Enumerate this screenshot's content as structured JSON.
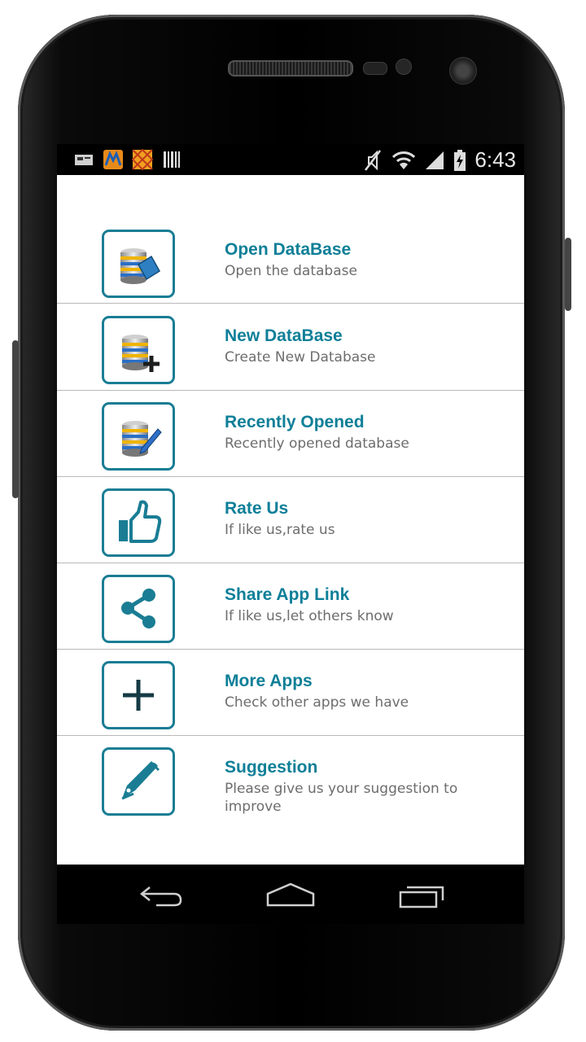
{
  "status_bar": {
    "time": "6:43",
    "left_icons": [
      "screenshot-icon",
      "app-notification-icon",
      "pattern-notification-icon",
      "barcode-icon"
    ],
    "right_icons": [
      "mute-icon",
      "wifi-icon",
      "signal-icon",
      "battery-charging-icon"
    ]
  },
  "menu": {
    "items": [
      {
        "title": "Open DataBase",
        "subtitle": "Open the database",
        "icon": "database-open-icon"
      },
      {
        "title": "New DataBase",
        "subtitle": "Create New Database",
        "icon": "database-add-icon"
      },
      {
        "title": "Recently Opened",
        "subtitle": "Recently opened database",
        "icon": "database-edit-icon"
      },
      {
        "title": "Rate Us",
        "subtitle": "If like us,rate us",
        "icon": "thumbs-up-icon"
      },
      {
        "title": "Share App Link",
        "subtitle": "If like us,let others know",
        "icon": "share-icon"
      },
      {
        "title": "More Apps",
        "subtitle": "Check other apps we have",
        "icon": "plus-icon"
      },
      {
        "title": "Suggestion",
        "subtitle": "Please give us your suggestion to improve",
        "icon": "pen-icon"
      }
    ]
  },
  "colors": {
    "accent": "#0e7f98",
    "subtitle": "#6d6d6d",
    "divider": "#b9b9b9"
  },
  "nav_bar": {
    "buttons": [
      "back-icon",
      "home-icon",
      "recent-apps-icon"
    ]
  }
}
